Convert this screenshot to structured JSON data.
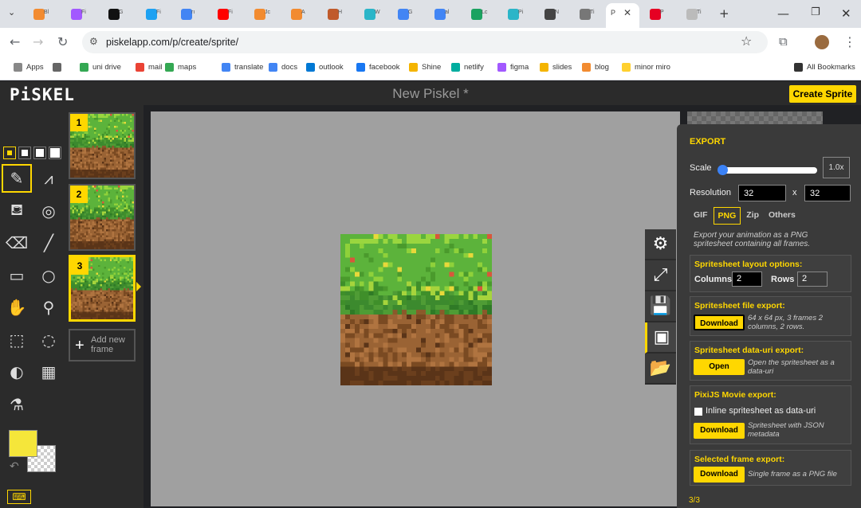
{
  "browser": {
    "tabs": [
      {
        "label": "Bl",
        "color": "#f28b30"
      },
      {
        "label": "Fi",
        "color": "#a259ff"
      },
      {
        "label": "G",
        "color": "#111111"
      },
      {
        "label": "Fi",
        "color": "#1da1f2"
      },
      {
        "label": "rı",
        "color": "#4285f4"
      },
      {
        "label": "Fi",
        "color": "#ff0000"
      },
      {
        "label": "Jc",
        "color": "#f28b30"
      },
      {
        "label": "A",
        "color": "#f28b30"
      },
      {
        "label": "H",
        "color": "#c05a2b"
      },
      {
        "label": "W",
        "color": "#2bb5c8"
      },
      {
        "label": "G",
        "color": "#4285f4"
      },
      {
        "label": "al",
        "color": "#4285f4"
      },
      {
        "label": "Lc",
        "color": "#1aa260"
      },
      {
        "label": "Pi",
        "color": "#2bb5c8"
      },
      {
        "label": "N",
        "color": "#444444"
      },
      {
        "label": "Ti",
        "color": "#777777"
      },
      {
        "label": "P",
        "color": "#888888"
      },
      {
        "label": "P",
        "color": "#e60023"
      },
      {
        "label": "Ti",
        "color": "#bbbbbb"
      }
    ],
    "url": "piskelapp.com/p/create/sprite/",
    "bookmarks": [
      {
        "label": "Apps",
        "color": "#888888"
      },
      {
        "label": "",
        "color": "#666666"
      },
      {
        "label": "uni drive",
        "color": "#34a853"
      },
      {
        "label": "mail",
        "color": "#ea4335"
      },
      {
        "label": "maps",
        "color": "#34a853"
      },
      {
        "label": "translate",
        "color": "#4285f4"
      },
      {
        "label": "docs",
        "color": "#4285f4"
      },
      {
        "label": "outlook",
        "color": "#0078d4"
      },
      {
        "label": "facebook",
        "color": "#1877f2"
      },
      {
        "label": "Shine",
        "color": "#f4b400"
      },
      {
        "label": "netlify",
        "color": "#00ad9f"
      },
      {
        "label": "figma",
        "color": "#a259ff"
      },
      {
        "label": "slides",
        "color": "#f4b400"
      },
      {
        "label": "blog",
        "color": "#f28b30"
      },
      {
        "label": "minor miro",
        "color": "#ffd02f"
      },
      {
        "label": "All Bookmarks",
        "color": "#333333"
      }
    ]
  },
  "app": {
    "logo": "PiSKEL",
    "title": "New Piskel *",
    "create_btn": "Create Sprite"
  },
  "frames": {
    "items": [
      {
        "number": "1"
      },
      {
        "number": "2"
      },
      {
        "number": "3"
      }
    ],
    "add_label": "Add new frame"
  },
  "colors": {
    "primary": "#f5e63a",
    "accent": "#ffd700"
  },
  "export": {
    "title": "EXPORT",
    "scale_label": "Scale",
    "scale_value": "1.0x",
    "resolution_label": "Resolution",
    "res_w": "32",
    "res_x": "x",
    "res_h": "32",
    "tabs": [
      "GIF",
      "PNG",
      "Zip",
      "Others"
    ],
    "png_desc": "Export your animation as a PNG spritesheet containing all frames.",
    "layout_title": "Spritesheet layout options:",
    "columns_label": "Columns",
    "columns_value": "2",
    "rows_label": "Rows",
    "rows_value": "2",
    "file_title": "Spritesheet file export:",
    "file_btn": "Download",
    "file_desc": "64 x 64 px, 3 frames 2 columns, 2 rows.",
    "datauri_title": "Spritesheet data-uri export:",
    "datauri_btn": "Open",
    "datauri_desc": "Open the spritesheet as a data-uri",
    "pixi_title": "PixiJS Movie export:",
    "pixi_chk": "Inline spritesheet as data-uri",
    "pixi_btn": "Download",
    "pixi_desc": "Spritesheet with JSON metadata",
    "sel_title": "Selected frame export:",
    "sel_btn": "Download",
    "sel_desc": "Single frame as a PNG file"
  },
  "status": {
    "frame_count": "3/3"
  }
}
